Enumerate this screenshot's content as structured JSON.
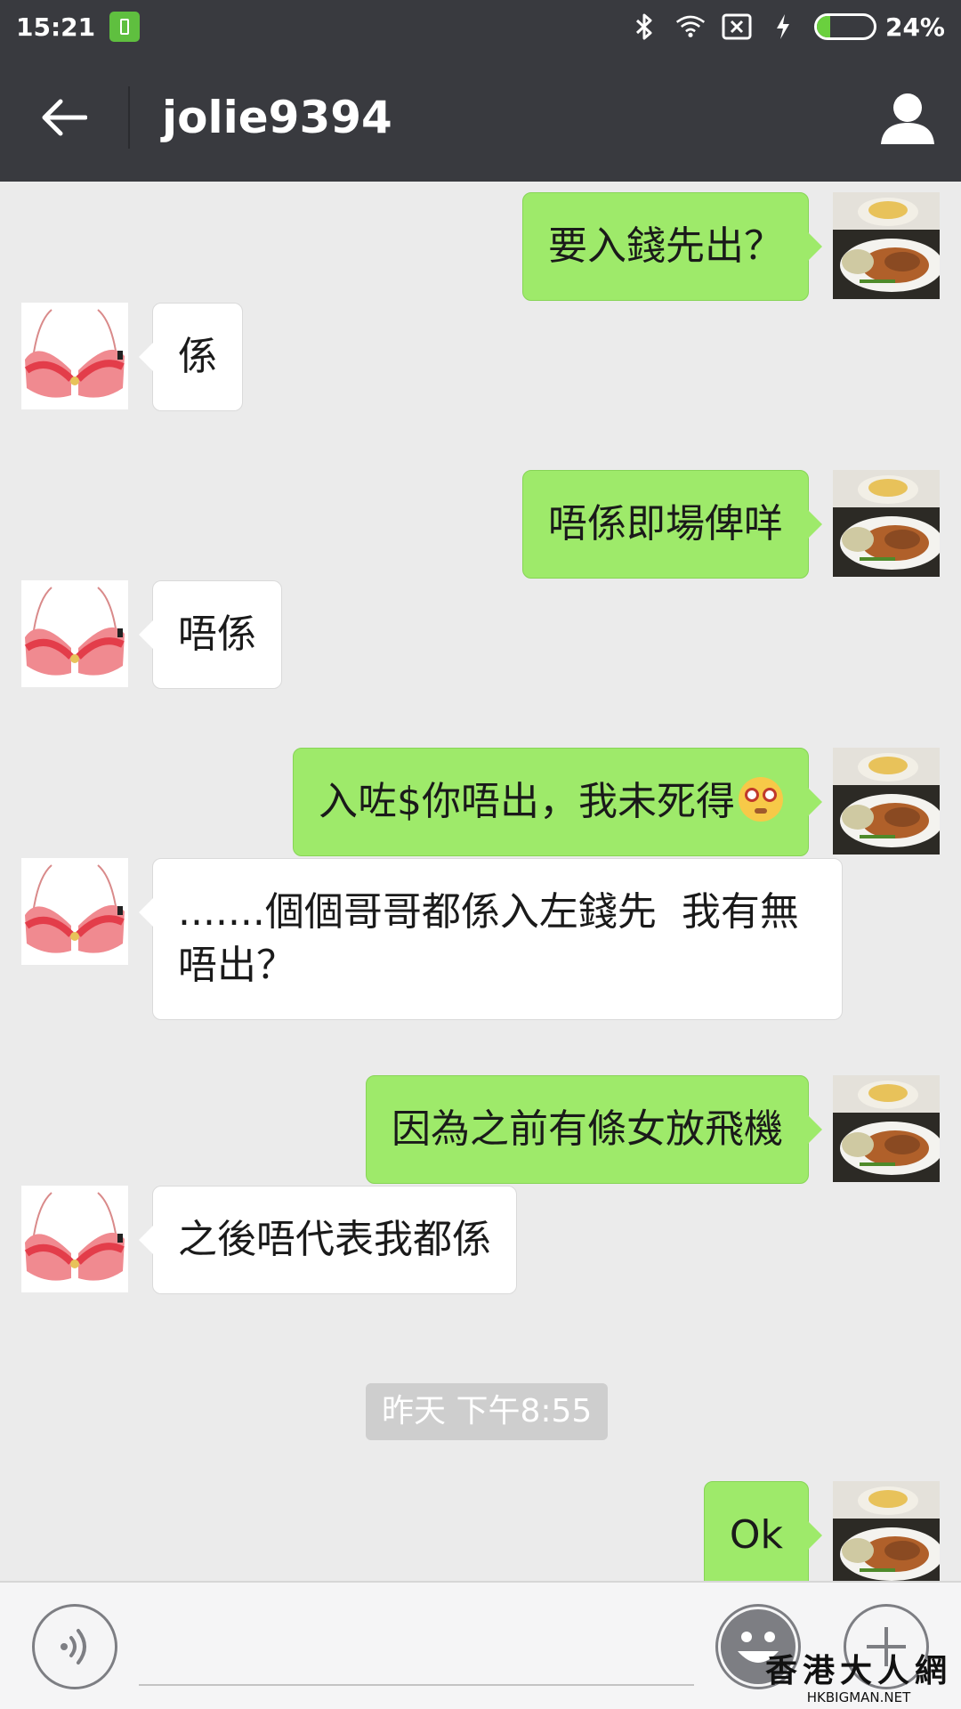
{
  "status_bar": {
    "time": "15:21",
    "battery_percent": "24%",
    "battery_level": 0.24,
    "icons": [
      "battery-app-icon",
      "bluetooth-icon",
      "wifi-icon",
      "no-sim-icon",
      "charging-icon",
      "battery-icon"
    ]
  },
  "header": {
    "title": "jolie9394",
    "back_icon": "back-arrow-icon",
    "profile_icon": "person-icon"
  },
  "conversation": [
    {
      "from": "me",
      "text": "要入錢先出？"
    },
    {
      "from": "them",
      "text": "係"
    },
    {
      "from": "me",
      "text": "唔係即場俾咩"
    },
    {
      "from": "them",
      "text": "唔係"
    },
    {
      "from": "me",
      "text": "入咗$你唔出，我未死得",
      "emoji": "dizzy-face-emoji"
    },
    {
      "from": "them",
      "text": ".......個個哥哥都係入左錢先  我有無唔出？"
    },
    {
      "from": "me",
      "text": "因為之前有條女放飛機"
    },
    {
      "from": "them",
      "text": "之後唔代表我都係"
    },
    {
      "from": "me",
      "text": "Ok"
    }
  ],
  "timestamp": "昨天 下午8:55",
  "input_bar": {
    "value": "",
    "voice_icon": "voice-icon",
    "emoji_icon": "smiley-icon",
    "plus_icon": "plus-icon"
  },
  "watermark": {
    "main": "香港大人網",
    "sub": "HKBIGMAN.NET"
  },
  "colors": {
    "header_bg": "#393a3f",
    "sent_bubble": "#9eea6a",
    "received_bubble": "#ffffff",
    "chat_bg": "#ebebeb"
  }
}
